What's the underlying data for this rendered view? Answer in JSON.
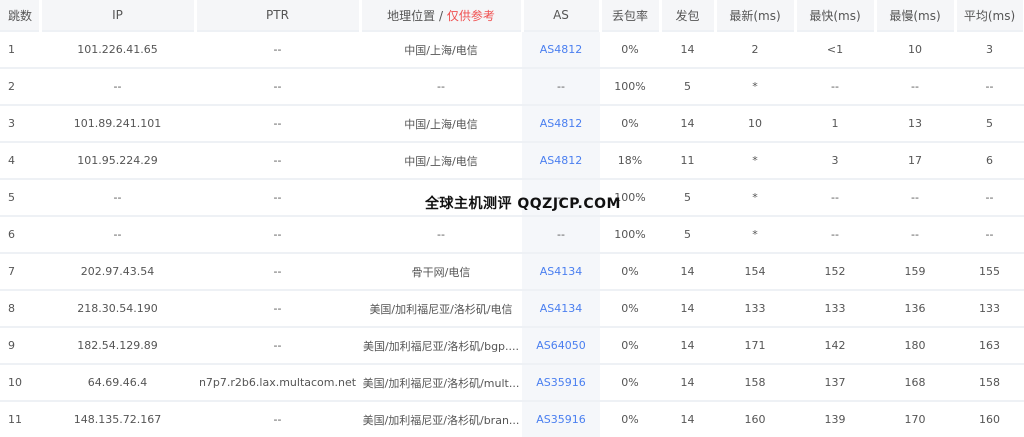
{
  "headers": {
    "hop": "跳数",
    "ip": "IP",
    "ptr": "PTR",
    "geo": "地理位置",
    "geo_sep": " / ",
    "geo_note": "仅供参考",
    "as": "AS",
    "loss": "丢包率",
    "sent": "发包",
    "last": "最新(ms)",
    "best": "最快(ms)",
    "worst": "最慢(ms)",
    "avg": "平均(ms)"
  },
  "rows": [
    [
      "1",
      "101.226.41.65",
      "--",
      "中国/上海/电信",
      "AS4812",
      "0%",
      "14",
      "2",
      "<1",
      "10",
      "3"
    ],
    [
      "2",
      "--",
      "--",
      "--",
      "--",
      "100%",
      "5",
      "*",
      "--",
      "--",
      "--"
    ],
    [
      "3",
      "101.89.241.101",
      "--",
      "中国/上海/电信",
      "AS4812",
      "0%",
      "14",
      "10",
      "1",
      "13",
      "5"
    ],
    [
      "4",
      "101.95.224.29",
      "--",
      "中国/上海/电信",
      "AS4812",
      "18%",
      "11",
      "*",
      "3",
      "17",
      "6"
    ],
    [
      "5",
      "--",
      "--",
      "--",
      "--",
      "100%",
      "5",
      "*",
      "--",
      "--",
      "--"
    ],
    [
      "6",
      "--",
      "--",
      "--",
      "--",
      "100%",
      "5",
      "*",
      "--",
      "--",
      "--"
    ],
    [
      "7",
      "202.97.43.54",
      "--",
      "骨干网/电信",
      "AS4134",
      "0%",
      "14",
      "154",
      "152",
      "159",
      "155"
    ],
    [
      "8",
      "218.30.54.190",
      "--",
      "美国/加利福尼亚/洛杉矶/电信",
      "AS4134",
      "0%",
      "14",
      "133",
      "133",
      "136",
      "133"
    ],
    [
      "9",
      "182.54.129.89",
      "--",
      "美国/加利福尼亚/洛杉矶/bgp....",
      "AS64050",
      "0%",
      "14",
      "171",
      "142",
      "180",
      "163"
    ],
    [
      "10",
      "64.69.46.4",
      "n7p7.r2b6.lax.multacom.net",
      "美国/加利福尼亚/洛杉矶/mult...",
      "AS35916",
      "0%",
      "14",
      "158",
      "137",
      "168",
      "158"
    ],
    [
      "11",
      "148.135.72.167",
      "--",
      "美国/加利福尼亚/洛杉矶/bran...",
      "AS35916",
      "0%",
      "14",
      "160",
      "139",
      "170",
      "160"
    ]
  ],
  "watermark": "全球主机测评 QQZJCP.COM",
  "colors": {
    "accent": "#4a7ff0",
    "note": "#f05050",
    "header_bg": "#f5f6f8"
  }
}
